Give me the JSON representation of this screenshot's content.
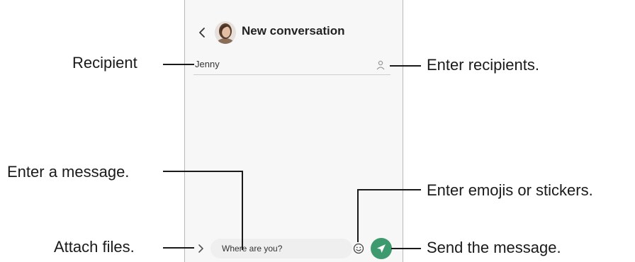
{
  "app": {
    "title": "New conversation"
  },
  "recipient": {
    "value": "Jenny"
  },
  "compose": {
    "message": "Where are you?"
  },
  "callouts": {
    "recipient": "Recipient",
    "enter_recipients": "Enter recipients.",
    "enter_message": "Enter a message.",
    "enter_emojis": "Enter emojis or stickers.",
    "attach_files": "Attach files.",
    "send_message": "Send the message."
  },
  "icons": {
    "back": "chevron-left-icon",
    "avatar": "contact-avatar",
    "add_recipient": "person-add-icon",
    "attach": "chevron-right-icon",
    "emoji": "smiley-icon",
    "send": "send-arrow-icon"
  },
  "colors": {
    "send_button": "#3d9a6e",
    "background": "#f7f7f7"
  }
}
